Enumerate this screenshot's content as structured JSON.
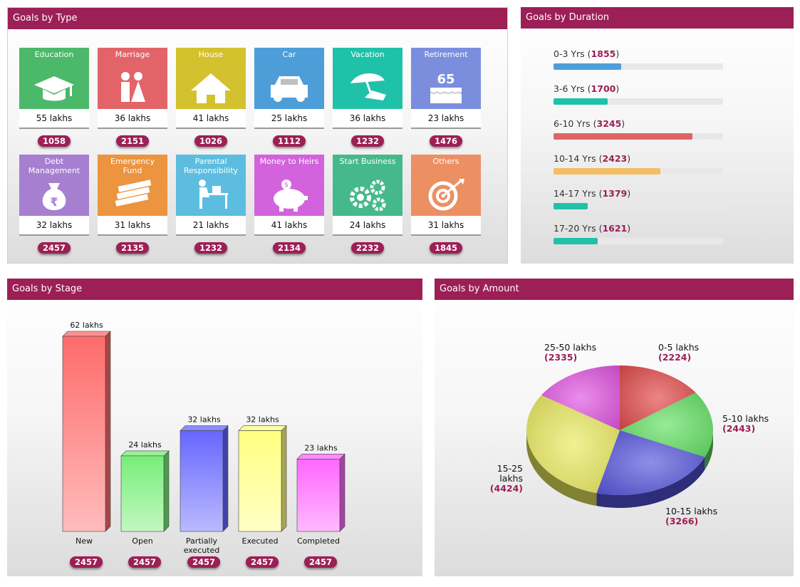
{
  "type_panel": {
    "title": "Goals by Type",
    "tiles": [
      {
        "label": "Education",
        "amount": "55 lakhs",
        "count": "1058",
        "color": "#4cb86a",
        "icon": "graduation-cap-icon"
      },
      {
        "label": "Marriage",
        "amount": "36 lakhs",
        "count": "2151",
        "color": "#e36468",
        "icon": "couple-icon"
      },
      {
        "label": "House",
        "amount": "41 lakhs",
        "count": "1026",
        "color": "#d4c12e",
        "icon": "house-icon"
      },
      {
        "label": "Car",
        "amount": "25 lakhs",
        "count": "1112",
        "color": "#4d9ed8",
        "icon": "car-icon"
      },
      {
        "label": "Vacation",
        "amount": "36 lakhs",
        "count": "1232",
        "color": "#20c1a9",
        "icon": "beach-umbrella-icon"
      },
      {
        "label": "Retirement",
        "amount": "23 lakhs",
        "count": "1476",
        "color": "#7b8ede",
        "icon": "cake-icon"
      },
      {
        "label": "Debt\nManagement",
        "amount": "32 lakhs",
        "count": "2457",
        "color": "#a77fd0",
        "icon": "money-bag-icon"
      },
      {
        "label": "Emergency\nFund",
        "amount": "31 lakhs",
        "count": "2135",
        "color": "#ec943f",
        "icon": "cash-stack-icon"
      },
      {
        "label": "Parental\nResponsibility",
        "amount": "21 lakhs",
        "count": "1232",
        "color": "#5cbde0",
        "icon": "study-desk-icon"
      },
      {
        "label": "Money to Heirs",
        "amount": "41 lakhs",
        "count": "2134",
        "color": "#d263dc",
        "icon": "piggy-bank-icon"
      },
      {
        "label": "Start Business",
        "amount": "24 lakhs",
        "count": "2232",
        "color": "#45b98c",
        "icon": "gears-icon"
      },
      {
        "label": "Others",
        "amount": "31 lakhs",
        "count": "1845",
        "color": "#ec8f63",
        "icon": "target-icon"
      }
    ]
  },
  "duration_panel": {
    "title": "Goals by Duration",
    "rows": [
      {
        "label": "0-3 Yrs",
        "count": "1855",
        "fill": 0.4,
        "color": "#4d9ed8"
      },
      {
        "label": "3-6 Yrs",
        "count": "1700",
        "fill": 0.32,
        "color": "#20c1a9"
      },
      {
        "label": "6-10 Yrs",
        "count": "3245",
        "fill": 0.82,
        "color": "#e06464"
      },
      {
        "label": "10-14 Yrs",
        "count": "2423",
        "fill": 0.63,
        "color": "#f4be64"
      },
      {
        "label": "14-17 Yrs",
        "count": "1379",
        "fill": 0.2,
        "color": "#20c1a9"
      },
      {
        "label": "17-20 Yrs",
        "count": "1621",
        "fill": 0.26,
        "color": "#20c1a9"
      }
    ]
  },
  "stage_panel": {
    "title": "Goals by Stage"
  },
  "amount_panel": {
    "title": "Goals by Amount"
  },
  "chart_data": [
    {
      "type": "bar",
      "categories": [
        "New",
        "Open",
        "Partially executed",
        "Executed",
        "Completed"
      ],
      "values": [
        62,
        24,
        32,
        32,
        23
      ],
      "data_labels": [
        "62 lakhs",
        "24 lakhs",
        "32 lakhs",
        "32 lakhs",
        "23 lakhs"
      ],
      "counts": [
        "2457",
        "2457",
        "2457",
        "2457",
        "2457"
      ],
      "colors": [
        "#ff6b6b",
        "#77ee77",
        "#6666ff",
        "#ffff80",
        "#ff66ff"
      ],
      "ylim": [
        0,
        62
      ]
    },
    {
      "type": "pie",
      "slices": [
        {
          "label": "0-5 lakhs",
          "count": "2224",
          "value": 2224,
          "color": "#e24545"
        },
        {
          "label": "5-10 lakhs",
          "count": "2443",
          "value": 2443,
          "color": "#5fe05f"
        },
        {
          "label": "10-15 lakhs",
          "count": "3266",
          "value": 3266,
          "color": "#5252dc"
        },
        {
          "label": "15-25 lakhs",
          "count": "4424",
          "value": 4424,
          "color": "#eaea5c"
        },
        {
          "label": "25-50 lakhs",
          "count": "2335",
          "value": 2335,
          "color": "#e050e0"
        }
      ]
    }
  ]
}
